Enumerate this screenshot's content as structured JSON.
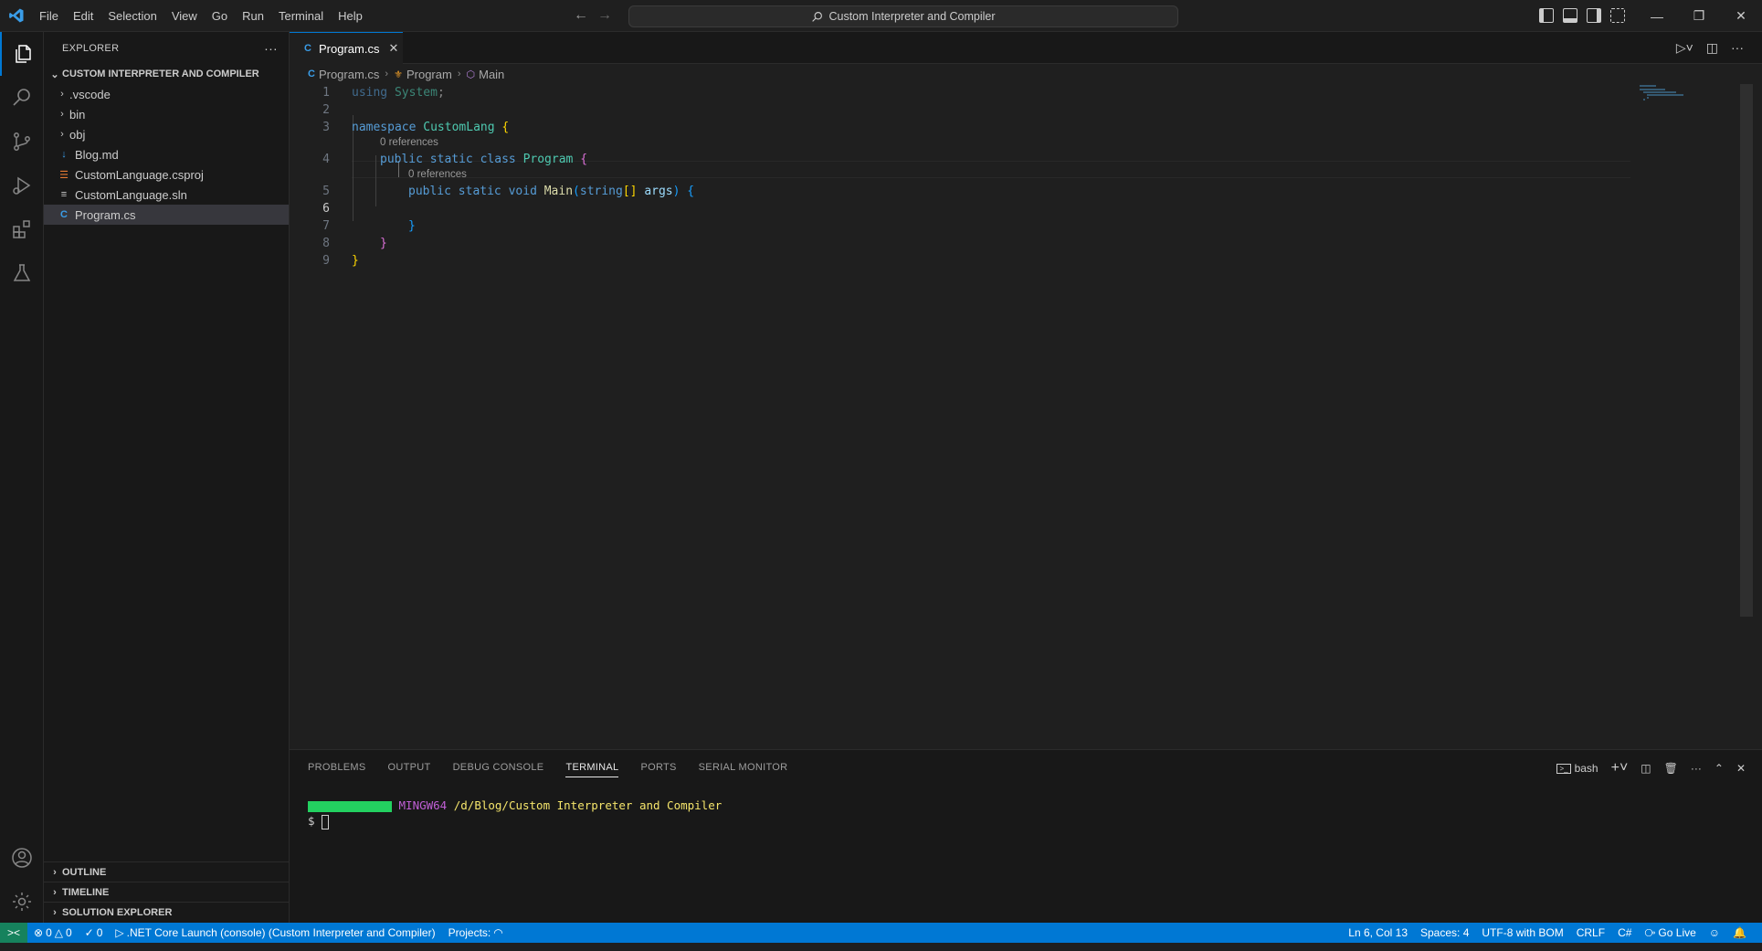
{
  "titlebar": {
    "menu": [
      "File",
      "Edit",
      "Selection",
      "View",
      "Go",
      "Run",
      "Terminal",
      "Help"
    ],
    "search": "Custom Interpreter and Compiler"
  },
  "sidebar": {
    "header": "EXPLORER",
    "more": "···",
    "folder": "CUSTOM INTERPRETER AND COMPILER",
    "items": [
      {
        "label": ".vscode",
        "type": "folder"
      },
      {
        "label": "bin",
        "type": "folder"
      },
      {
        "label": "obj",
        "type": "folder"
      },
      {
        "label": "Blog.md",
        "type": "md"
      },
      {
        "label": "CustomLanguage.csproj",
        "type": "csproj"
      },
      {
        "label": "CustomLanguage.sln",
        "type": "sln"
      },
      {
        "label": "Program.cs",
        "type": "cs"
      }
    ],
    "bottom_sections": [
      "OUTLINE",
      "TIMELINE",
      "SOLUTION EXPLORER"
    ]
  },
  "editor": {
    "tab": "Program.cs",
    "breadcrumb": [
      "Program.cs",
      "Program",
      "Main"
    ],
    "lens": [
      "0 references",
      "0 references"
    ],
    "line_numbers": [
      "1",
      "2",
      "3",
      "4",
      "5",
      "6",
      "7",
      "8",
      "9"
    ],
    "current_line": "6"
  },
  "panel": {
    "tabs": [
      "PROBLEMS",
      "OUTPUT",
      "DEBUG CONSOLE",
      "TERMINAL",
      "PORTS",
      "SERIAL MONITOR"
    ],
    "active_tab": "TERMINAL",
    "shell": "bash",
    "terminal": {
      "host": "MINGW64",
      "path": "/d/Blog/Custom Interpreter and Compiler",
      "prompt": "$"
    }
  },
  "statusbar": {
    "errors": "0",
    "warnings": "0",
    "ports": "0",
    "launch": ".NET Core Launch (console) (Custom Interpreter and Compiler)",
    "projects": "Projects:",
    "position": "Ln 6, Col 13",
    "spaces": "Spaces: 4",
    "encoding": "UTF-8 with BOM",
    "eol": "CRLF",
    "language": "C#",
    "golive": "Go Live"
  },
  "colors": {
    "accent": "#0078d4",
    "remote": "#16825d",
    "keyword": "#569cd6",
    "type": "#4ec9b0",
    "function": "#dcdcaa"
  }
}
